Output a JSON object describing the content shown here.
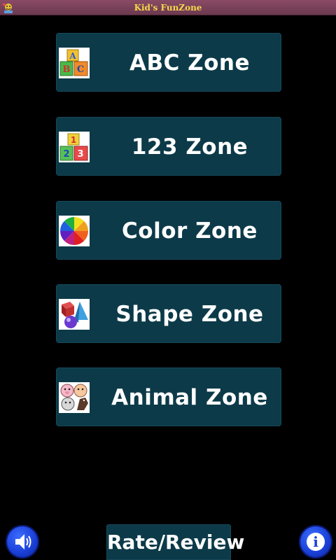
{
  "titlebar": {
    "title": "Kid's FunZone",
    "icon": "app-logo-icon"
  },
  "zones": [
    {
      "label": "ABC Zone",
      "icon": "abc-blocks-icon"
    },
    {
      "label": "123 Zone",
      "icon": "number-blocks-icon"
    },
    {
      "label": "Color Zone",
      "icon": "color-wheel-icon"
    },
    {
      "label": "Shape Zone",
      "icon": "shapes-icon"
    },
    {
      "label": "Animal Zone",
      "icon": "animals-icon"
    }
  ],
  "footer": {
    "rate_label": "Rate/Review",
    "sound_icon": "speaker-icon",
    "info_icon": "info-icon",
    "info_glyph": "i"
  },
  "colors": {
    "background": "#000000",
    "button": "#0c3a49",
    "title_text": "#f5d84a",
    "titlebar": "#7a4259",
    "round_button": "#1a3fd6"
  }
}
